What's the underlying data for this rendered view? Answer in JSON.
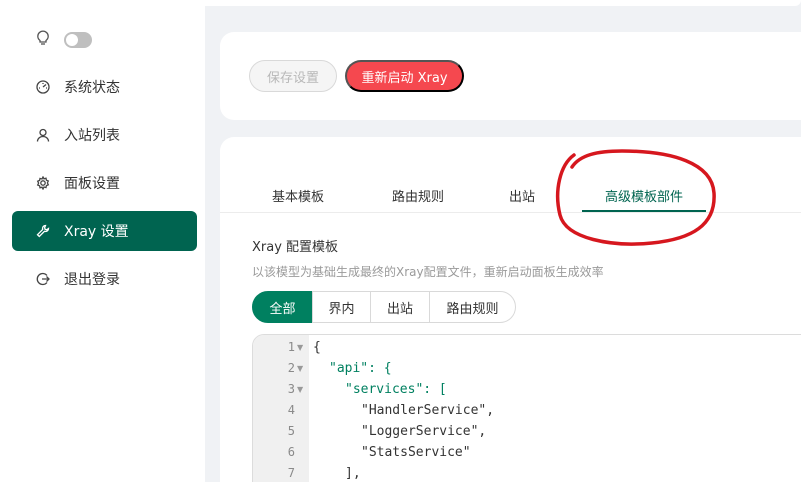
{
  "sidebar": {
    "items": [
      {
        "label": "系统状态",
        "icon": "dashboard-icon"
      },
      {
        "label": "入站列表",
        "icon": "user-icon"
      },
      {
        "label": "面板设置",
        "icon": "gear-icon"
      },
      {
        "label": "Xray 设置",
        "icon": "wrench-icon"
      },
      {
        "label": "退出登录",
        "icon": "logout-icon"
      }
    ],
    "active_item": "Xray 设置"
  },
  "toolbar": {
    "save_label": "保存设置",
    "restart_label": "重新启动 Xray"
  },
  "tabs": [
    {
      "label": "基本模板"
    },
    {
      "label": "路由规则"
    },
    {
      "label": "出站"
    },
    {
      "label": "高级模板部件"
    }
  ],
  "active_tab": "高级模板部件",
  "section": {
    "title": "Xray 配置模板",
    "description": "以该模型为基础生成最终的Xray配置文件，重新启动面板生成效率"
  },
  "filter": {
    "options": [
      "全部",
      "界内",
      "出站",
      "路由规则"
    ],
    "selected": "全部"
  },
  "editor": {
    "lines": [
      {
        "n": "1",
        "text": "{"
      },
      {
        "n": "2",
        "text": "\"api\": {"
      },
      {
        "n": "3",
        "text": "\"services\": ["
      },
      {
        "n": "4",
        "text": "\"HandlerService\","
      },
      {
        "n": "5",
        "text": "\"LoggerService\","
      },
      {
        "n": "6",
        "text": "\"StatsService\""
      },
      {
        "n": "7",
        "text": "],"
      }
    ]
  },
  "colors": {
    "accent": "#006450",
    "danger": "#f5484f",
    "annotation": "#d6171e"
  }
}
